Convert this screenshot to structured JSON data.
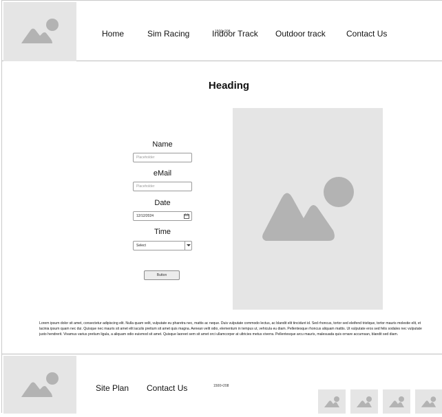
{
  "header": {
    "nav": [
      "Home",
      "Sim Racing",
      "Indoor Track",
      "Outdoor track",
      "Contact Us"
    ],
    "size_note": "1500×208"
  },
  "main": {
    "heading": "Heading",
    "form": {
      "name_label": "Name",
      "name_placeholder": "Placeholder",
      "email_label": "eMail",
      "email_placeholder": "Placeholder",
      "date_label": "Date",
      "date_value": "12/12/2024",
      "time_label": "Time",
      "time_value": "Select",
      "button_label": "Button"
    },
    "paragraph": "Lorem ipsum dolor sit amet, consectetur adipiscing elit. Nulla quam velit, vulputate eu pharetra nec, mattis ac neque. Duis vulputate commodo lectus, ac blandit elit tincidunt id. Sed rhoncus, tortor sed eleifend tristique, tortor mauris molestie elit, et lacinia ipsum quam nec dui. Quisque nec mauris sit amet elit iaculis pretium sit amet quis magna. Aenean velit odio, elementum in tempus ut, vehicula eu diam. Pellentesque rhoncus aliquam mattis. Ut vulputate eros sed felis sodales nec vulputate justo hendrerit. Vivamus varius pretium ligula, a aliquam odio euismod sit amet. Quisque laoreet sem sit amet orci ullamcorper at ultricies metus viverra. Pellentesque arcu mauris, malesuada quis ornare accumsan, blandit sed diam."
  },
  "footer": {
    "links": [
      "Site Plan",
      "Contact Us"
    ],
    "size_note": "1500×208"
  },
  "colors": {
    "placeholder_fill": "#e5e5e5",
    "placeholder_icon": "#b3b3b3"
  }
}
